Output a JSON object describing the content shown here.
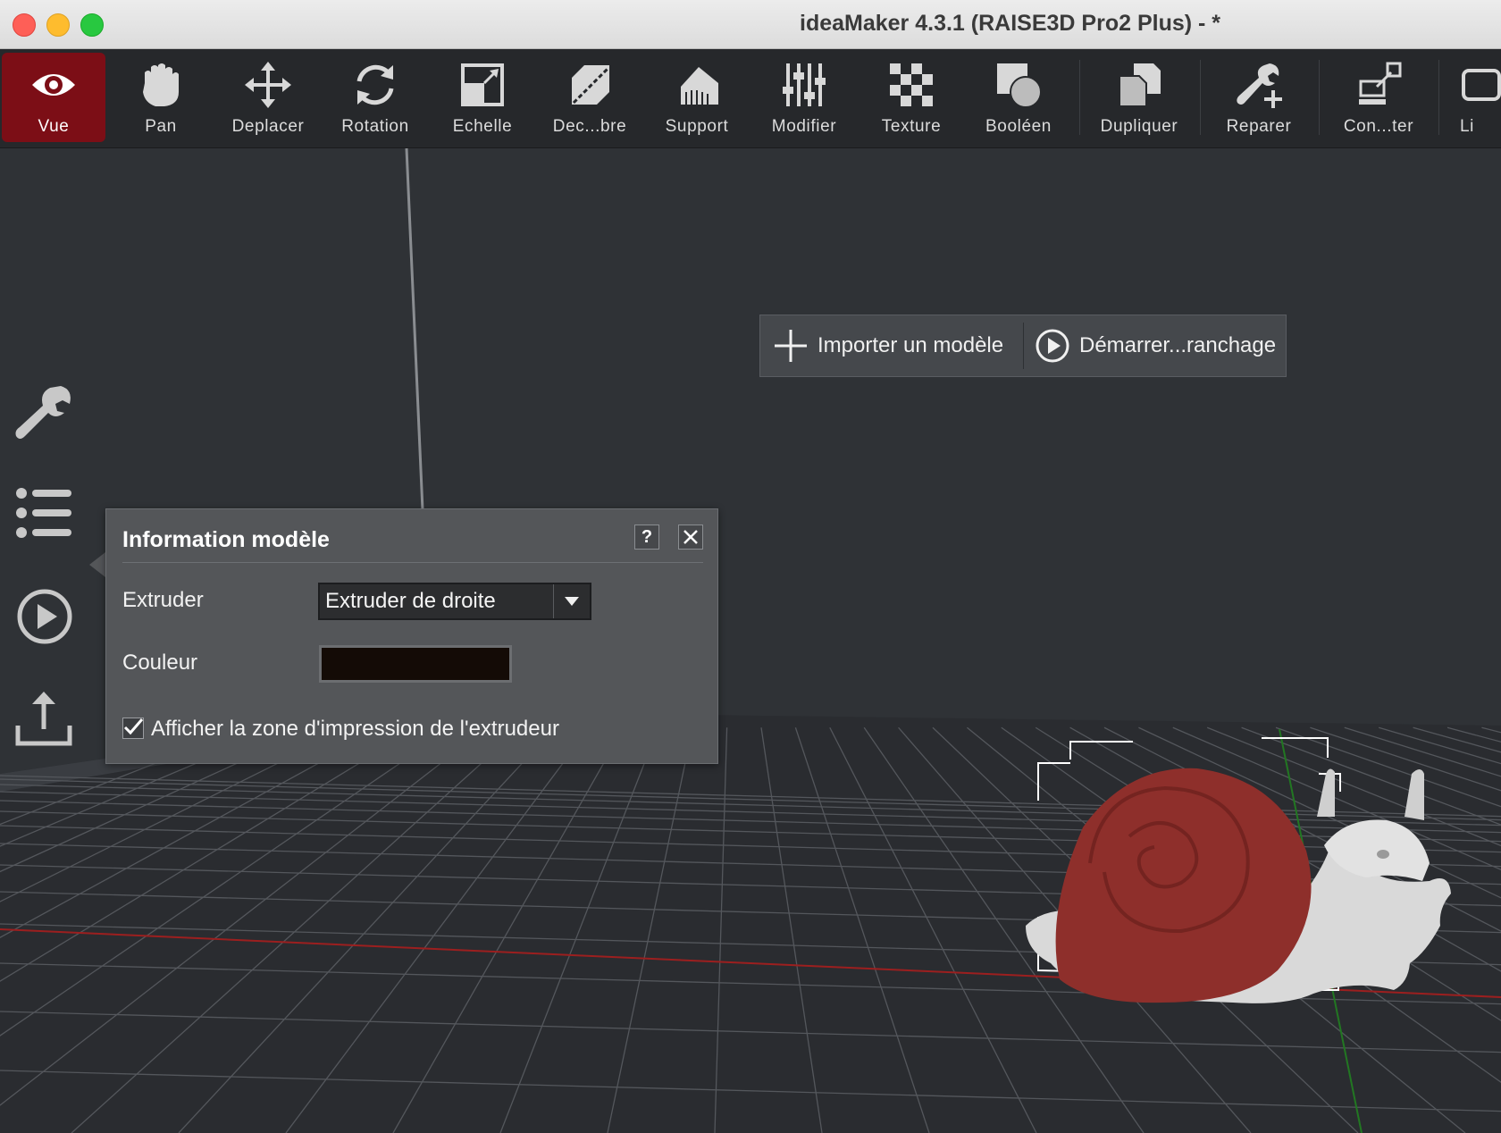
{
  "window": {
    "title": "ideaMaker 4.3.1 (RAISE3D Pro2 Plus) - *"
  },
  "toolbar": {
    "items": [
      {
        "label": "Vue",
        "icon": "eye-icon",
        "active": true
      },
      {
        "label": "Pan",
        "icon": "hand-icon"
      },
      {
        "label": "Deplacer",
        "icon": "move-arrows-icon"
      },
      {
        "label": "Rotation",
        "icon": "rotate-icon"
      },
      {
        "label": "Echelle",
        "icon": "scale-icon"
      },
      {
        "label": "Dec...bre",
        "icon": "cut-icon"
      },
      {
        "label": "Support",
        "icon": "support-icon"
      },
      {
        "label": "Modifier",
        "icon": "sliders-icon"
      },
      {
        "label": "Texture",
        "icon": "checker-icon"
      },
      {
        "label": "Booléen",
        "icon": "boolean-icon"
      },
      {
        "label": "Dupliquer",
        "icon": "duplicate-icon"
      },
      {
        "label": "Reparer",
        "icon": "wrench-plus-icon"
      },
      {
        "label": "Con...ter",
        "icon": "connect-icon"
      },
      {
        "label": "Li",
        "icon": "truncated-icon"
      }
    ],
    "active_color": "#7c0e16"
  },
  "actions": {
    "import_label": "Importer un modèle",
    "start_label": "Démarrer...ranchage"
  },
  "side_rail": {
    "icons": [
      "wrench-icon",
      "list-icon",
      "play-circle-icon",
      "upload-icon"
    ]
  },
  "dialog": {
    "title": "Information modèle",
    "help": "?",
    "extruder_label": "Extruder",
    "extruder_value": "Extruder de droite",
    "color_label": "Couleur",
    "color_value": "#140b06",
    "show_zone_label": "Afficher la zone d'impression de l'extrudeur",
    "show_zone_checked": true
  },
  "model": {
    "shell_color": "#8e2f2b",
    "body_color": "#d9d9d9"
  }
}
